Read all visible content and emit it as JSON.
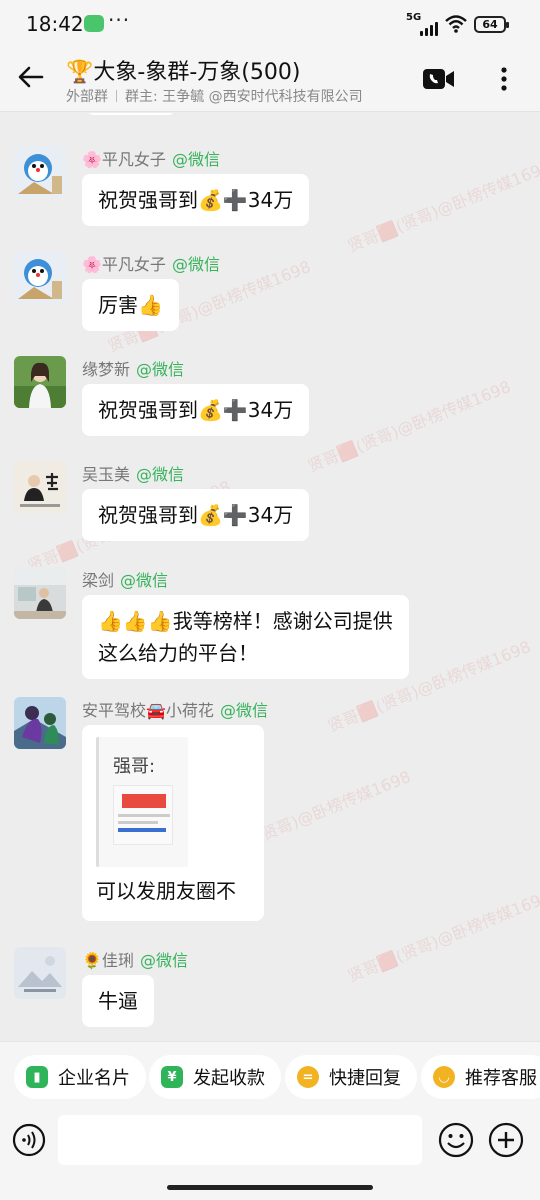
{
  "status_bar": {
    "time": "18:42",
    "app_dots": "···",
    "network": "5G",
    "battery": "64"
  },
  "header": {
    "title": "🏆大象-象群-万象(500)",
    "tag": "外部群",
    "owner_text": "群主: 王争毓 @西安时代科技有限公司"
  },
  "messages": [
    {
      "sender": "🌸平凡女子",
      "source": "@微信",
      "text": "祝贺强哥到💰➕34万",
      "avatar": "cartoon"
    },
    {
      "sender": "🌸平凡女子",
      "source": "@微信",
      "text": "厉害👍",
      "avatar": "cartoon"
    },
    {
      "sender": "缘梦新",
      "source": "@微信",
      "text": "祝贺强哥到💰➕34万",
      "avatar": "girl-green"
    },
    {
      "sender": "吴玉美",
      "source": "@微信",
      "text": "祝贺强哥到💰➕34万",
      "avatar": "calligraphy"
    },
    {
      "sender": "梁剑",
      "source": "@微信",
      "text_line1": "👍👍👍我等榜样！感谢公司提供",
      "text_line2": "这么给力的平台！",
      "avatar": "office"
    },
    {
      "sender": "安平驾校🚘小荷花",
      "source": "@微信",
      "quote_text": "强哥:",
      "text": "可以发朋友圈不",
      "avatar": "anime"
    },
    {
      "sender": "🌻佳琍",
      "source": "@微信",
      "text": "牛逼",
      "avatar": "landscape"
    }
  ],
  "watermark_text": "贤哥🟥(贤哥)@卧榜传媒1698",
  "quick_actions": [
    {
      "label": "企业名片",
      "icon": "card-icon",
      "color": "#2fb45a"
    },
    {
      "label": "发起收款",
      "icon": "yen-icon",
      "color": "#2fb45a"
    },
    {
      "label": "快捷回复",
      "icon": "quick-reply-icon",
      "color": "#f2b322"
    },
    {
      "label": "推荐客服",
      "icon": "service-icon",
      "color": "#f2b322"
    }
  ],
  "input": {
    "placeholder": ""
  }
}
